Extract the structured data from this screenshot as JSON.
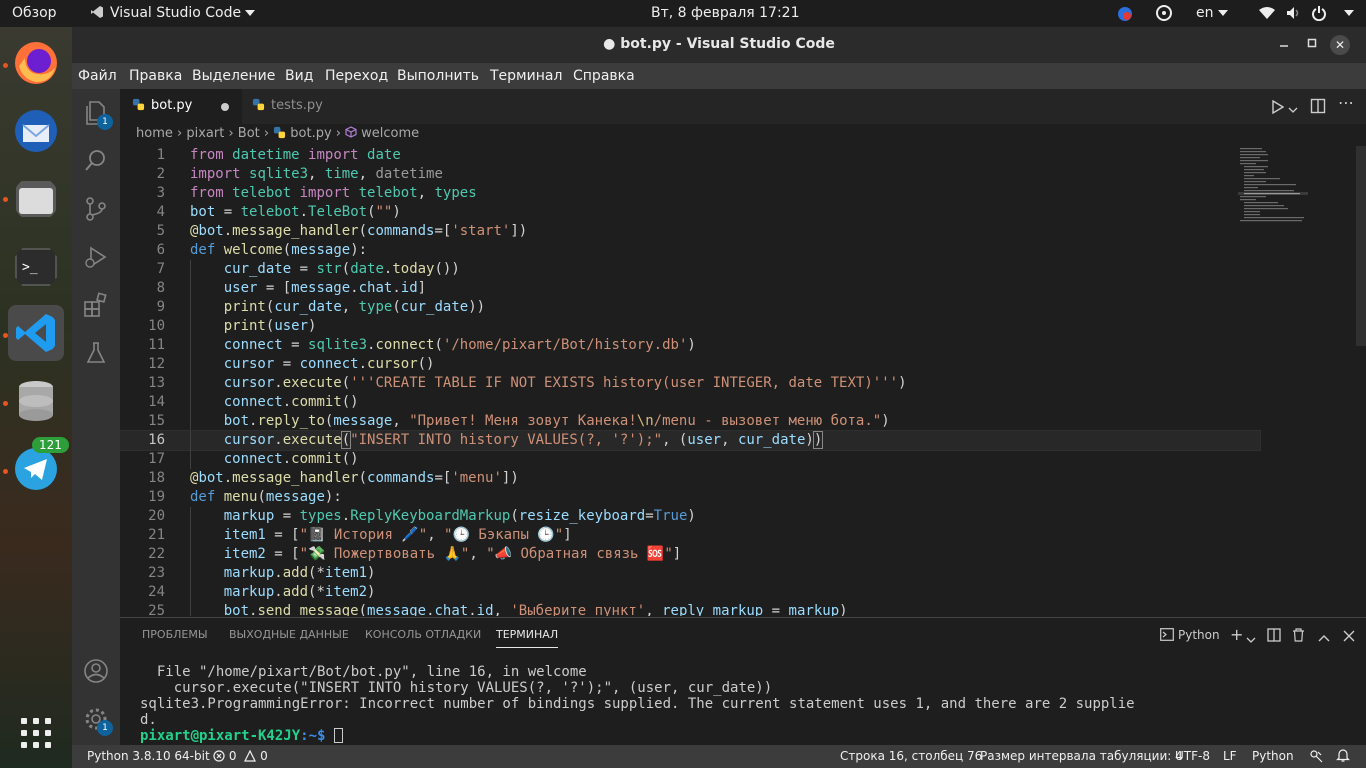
{
  "topbar": {
    "overview": "Обзор",
    "app_name": "Visual Studio Code",
    "datetime": "Вт, 8 февраля  17:21",
    "lang": "en"
  },
  "dock": {
    "telegram_badge": "121"
  },
  "window": {
    "title": "● bot.py - Visual Studio Code"
  },
  "menu": [
    "Файл",
    "Правка",
    "Выделение",
    "Вид",
    "Переход",
    "Выполнить",
    "Терминал",
    "Справка"
  ],
  "activity": {
    "explorer_badge": "1",
    "settings_badge": "1"
  },
  "tabs": [
    {
      "label": "bot.py"
    },
    {
      "label": "tests.py"
    }
  ],
  "breadcrumb": [
    "home",
    "pixart",
    "Bot",
    "bot.py",
    "welcome"
  ],
  "editor": {
    "current_line": 16,
    "lines": [
      {
        "n": "1"
      },
      {
        "n": "2"
      },
      {
        "n": "3"
      },
      {
        "n": "4"
      },
      {
        "n": "5"
      },
      {
        "n": "6"
      },
      {
        "n": "7"
      },
      {
        "n": "8"
      },
      {
        "n": "9"
      },
      {
        "n": "10"
      },
      {
        "n": "11"
      },
      {
        "n": "12"
      },
      {
        "n": "13"
      },
      {
        "n": "14"
      },
      {
        "n": "15"
      },
      {
        "n": "16"
      },
      {
        "n": "17"
      },
      {
        "n": "18"
      },
      {
        "n": "19"
      },
      {
        "n": "20"
      },
      {
        "n": "21"
      },
      {
        "n": "22"
      },
      {
        "n": "23"
      },
      {
        "n": "24"
      },
      {
        "n": "25"
      }
    ]
  },
  "panel": {
    "tabs": [
      "ПРОБЛЕМЫ",
      "ВЫХОДНЫЕ ДАННЫЕ",
      "КОНСОЛЬ ОТЛАДКИ",
      "ТЕРМИНАЛ"
    ],
    "shell": "Python",
    "terminal": [
      "  File \"/home/pixart/Bot/bot.py\", line 16, in welcome",
      "    cursor.execute(\"INSERT INTO history VALUES(?, '?');\", (user, cur_date))",
      "sqlite3.ProgrammingError: Incorrect number of bindings supplied. The current statement uses 1, and there are 2 supplie",
      "d."
    ],
    "prompt_user": "pixart@pixart-K42JY",
    "prompt_path": ":~$"
  },
  "status": {
    "interpreter": "Python 3.8.10 64-bit",
    "errors": "0",
    "warnings": "0",
    "position": "Строка 16, столбец 76",
    "tab_size": "Размер интервала табуляции: 4",
    "encoding": "UTF-8",
    "eol": "LF",
    "language": "Python"
  }
}
